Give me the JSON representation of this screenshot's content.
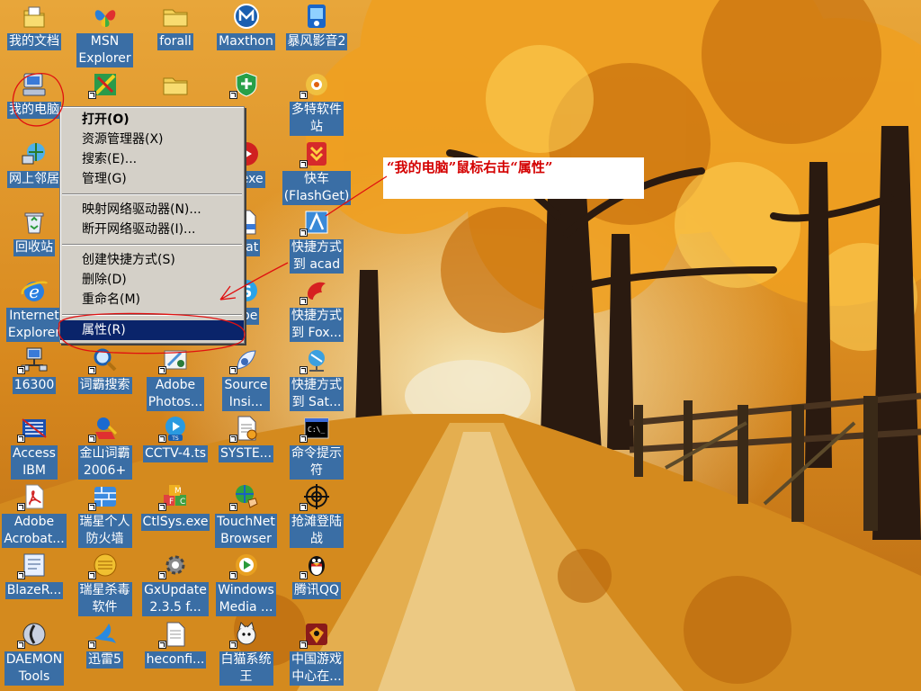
{
  "desktop": {
    "icons": [
      {
        "label": "我的文档",
        "icon": "my-documents-icon",
        "shortcut": false
      },
      {
        "label": "MSN\nExplorer",
        "icon": "msn-butterfly-icon",
        "shortcut": false
      },
      {
        "label": "forall",
        "icon": "folder-icon",
        "shortcut": false
      },
      {
        "label": "Maxthon",
        "icon": "maxthon-icon",
        "shortcut": false
      },
      {
        "label": "暴风影音2",
        "icon": "media-player-icon",
        "shortcut": false
      },
      {
        "label": "我的电脑",
        "icon": "my-computer-icon",
        "shortcut": false
      },
      {
        "label": "",
        "icon": "program-icon",
        "shortcut": true
      },
      {
        "label": "",
        "icon": "folder-icon",
        "shortcut": false
      },
      {
        "label": "",
        "icon": "shield-icon",
        "shortcut": true
      },
      {
        "label": "多特软件\n站",
        "icon": "web-shortcut-icon",
        "shortcut": true
      },
      {
        "label": "网上邻居",
        "icon": "network-places-icon",
        "shortcut": false
      },
      {
        "label": "",
        "icon": "blank",
        "shortcut": false
      },
      {
        "label": "",
        "icon": "blank",
        "shortcut": false
      },
      {
        "label": "p.exe",
        "icon": "exe-icon",
        "shortcut": true
      },
      {
        "label": "快车\n(FlashGet)",
        "icon": "flashget-icon",
        "shortcut": true
      },
      {
        "label": "回收站",
        "icon": "recycle-bin-icon",
        "shortcut": false
      },
      {
        "label": "",
        "icon": "blank",
        "shortcut": false
      },
      {
        "label": "",
        "icon": "blank",
        "shortcut": false
      },
      {
        "label": ".dat",
        "icon": "file-icon",
        "shortcut": true
      },
      {
        "label": "快捷方式\n到 acad",
        "icon": "autocad-icon",
        "shortcut": true
      },
      {
        "label": "Internet\nExplorer",
        "icon": "internet-explorer-icon",
        "shortcut": false
      },
      {
        "label": "",
        "icon": "blank",
        "shortcut": false
      },
      {
        "label": "",
        "icon": "blank",
        "shortcut": false
      },
      {
        "label": "ype",
        "icon": "skype-icon",
        "shortcut": true
      },
      {
        "label": "快捷方式\n到 Fox...",
        "icon": "foxmail-icon",
        "shortcut": true
      },
      {
        "label": "16300",
        "icon": "computer-network-icon",
        "shortcut": true
      },
      {
        "label": "词霸搜索",
        "icon": "magnifier-icon",
        "shortcut": true
      },
      {
        "label": "Adobe\nPhotos...",
        "icon": "photoshop-icon",
        "shortcut": true
      },
      {
        "label": "Source\nInsi...",
        "icon": "source-insight-icon",
        "shortcut": true
      },
      {
        "label": "快捷方式\n到 Sat...",
        "icon": "satellite-icon",
        "shortcut": true
      },
      {
        "label": "Access\nIBM",
        "icon": "ibm-icon",
        "shortcut": true
      },
      {
        "label": "金山词霸\n2006+",
        "icon": "dictionary-icon",
        "shortcut": true
      },
      {
        "label": "CCTV-4.ts",
        "icon": "video-file-icon",
        "shortcut": true
      },
      {
        "label": "SYSTE...",
        "icon": "system-file-icon",
        "shortcut": true
      },
      {
        "label": "命令提示\n符",
        "icon": "command-prompt-icon",
        "shortcut": true
      },
      {
        "label": "Adobe\nAcrobat...",
        "icon": "acrobat-icon",
        "shortcut": true
      },
      {
        "label": "瑞星个人\n防火墙",
        "icon": "firewall-icon",
        "shortcut": true
      },
      {
        "label": "CtlSys.exe",
        "icon": "blocks-icon",
        "shortcut": true
      },
      {
        "label": "TouchNet\nBrowser",
        "icon": "globe-hand-icon",
        "shortcut": true
      },
      {
        "label": "抢滩登陆\n战",
        "icon": "crosshair-icon",
        "shortcut": true
      },
      {
        "label": "BlazeR...",
        "icon": "blazer-icon",
        "shortcut": true
      },
      {
        "label": "瑞星杀毒\n软件",
        "icon": "antivirus-icon",
        "shortcut": true
      },
      {
        "label": "GxUpdate\n2.3.5 f...",
        "icon": "gear-update-icon",
        "shortcut": true
      },
      {
        "label": "Windows\nMedia ...",
        "icon": "windows-media-icon",
        "shortcut": true
      },
      {
        "label": "腾讯QQ",
        "icon": "qq-penguin-icon",
        "shortcut": true
      },
      {
        "label": "DAEMON\nTools",
        "icon": "daemon-tools-icon",
        "shortcut": true
      },
      {
        "label": "迅雷5",
        "icon": "thunder-icon",
        "shortcut": true
      },
      {
        "label": "heconfi...",
        "icon": "config-file-icon",
        "shortcut": true
      },
      {
        "label": "白猫系统\n王",
        "icon": "white-cat-icon",
        "shortcut": true
      },
      {
        "label": "中国游戏\n中心在...",
        "icon": "game-center-icon",
        "shortcut": true
      }
    ]
  },
  "context_menu": {
    "groups": [
      [
        {
          "label": "打开(O)",
          "bold": true
        },
        {
          "label": "资源管理器(X)"
        },
        {
          "label": "搜索(E)..."
        },
        {
          "label": "管理(G)"
        }
      ],
      [
        {
          "label": "映射网络驱动器(N)..."
        },
        {
          "label": "断开网络驱动器(I)..."
        }
      ],
      [
        {
          "label": "创建快捷方式(S)"
        },
        {
          "label": "删除(D)"
        },
        {
          "label": "重命名(M)"
        }
      ],
      [
        {
          "label": "属性(R)",
          "selected": true
        }
      ]
    ]
  },
  "annotation": {
    "text": "“我的电脑”鼠标右击“属性”",
    "color": "#d40000"
  },
  "colors": {
    "label_bg": "#3a6ea5",
    "menu_bg": "#d4d0c8",
    "menu_highlight": "#0a246a"
  }
}
